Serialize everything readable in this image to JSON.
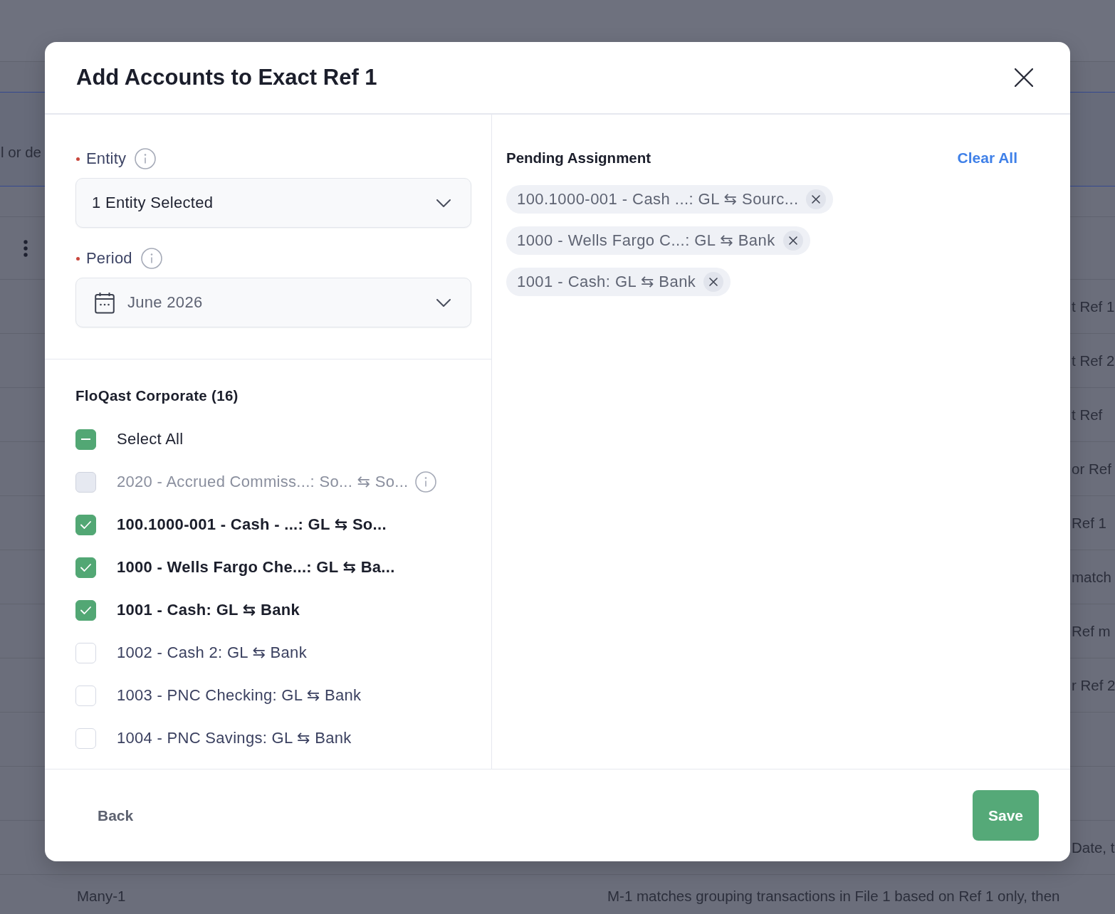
{
  "background": {
    "band_text": "l or de",
    "right_cells": [
      "t Ref 1",
      "t Ref 2",
      "t Ref",
      "or Ref",
      "Ref 1",
      "match",
      "Ref m",
      "r Ref 2"
    ],
    "date_text": "Date, t",
    "bottom_row": {
      "name": "Many-1",
      "description": "M-1 matches grouping transactions in File 1 based on Ref 1 only, then"
    }
  },
  "dialog": {
    "title": "Add Accounts to Exact Ref 1"
  },
  "filters": [
    {
      "kind": "select",
      "label": "Entity",
      "required": true,
      "value": "1 Entity Selected"
    },
    {
      "kind": "date",
      "label": "Period",
      "required": true,
      "value": "June 2026"
    }
  ],
  "account_list": {
    "heading": "FloQast Corporate (16)",
    "select_all": {
      "label": "Select All",
      "indeterminate": true
    },
    "items": [
      {
        "label": "2020 - Accrued Commiss...: So... ⇆ So...",
        "checked": false,
        "disabled": true
      },
      {
        "label": "100.1000-001 - Cash - ...: GL ⇆ So...",
        "checked": true,
        "disabled": false
      },
      {
        "label": "1000 - Wells Fargo Che...: GL ⇆ Ba...",
        "checked": true,
        "disabled": false
      },
      {
        "label": "1001 - Cash: GL ⇆ Bank",
        "checked": true,
        "disabled": false
      },
      {
        "label": "1002 - Cash 2: GL ⇆ Bank",
        "checked": false,
        "disabled": false
      },
      {
        "label": "1003 - PNC Checking: GL ⇆ Bank",
        "checked": false,
        "disabled": false
      },
      {
        "label": "1004 - PNC Savings: GL ⇆ Bank",
        "checked": false,
        "disabled": false
      }
    ]
  },
  "pending": {
    "title": "Pending Assignment",
    "clear_label": "Clear All",
    "chips": [
      "100.1000-001 - Cash ...: GL ⇆ Sourc...",
      "1000 - Wells Fargo C...: GL ⇆ Bank",
      "1001 - Cash: GL ⇆ Bank"
    ]
  },
  "footer": {
    "back_label": "Back",
    "save_label": "Save"
  }
}
